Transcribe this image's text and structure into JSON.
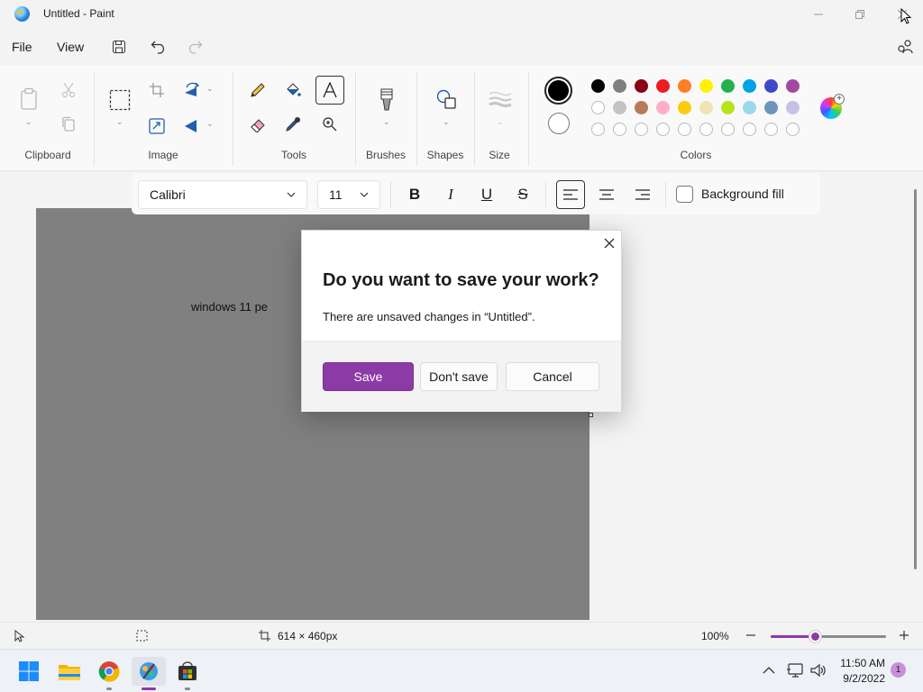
{
  "window": {
    "title": "Untitled - Paint"
  },
  "menu": {
    "file": "File",
    "view": "View"
  },
  "ribbon": {
    "groups": {
      "clipboard": "Clipboard",
      "image": "Image",
      "tools": "Tools",
      "brushes": "Brushes",
      "shapes": "Shapes",
      "size": "Size",
      "colors": "Colors"
    },
    "colors": {
      "primary": "#000000",
      "secondary": "#ffffff",
      "row1": [
        "#000000",
        "#7f7f7f",
        "#880015",
        "#ed1c24",
        "#ff7f27",
        "#fff200",
        "#22b14c",
        "#00a2e8",
        "#3f48cc",
        "#a349a4"
      ],
      "row2": [
        "#ffffff",
        "#c3c3c3",
        "#b97a57",
        "#ffaec9",
        "#ffc90e",
        "#efe4b0",
        "#b5e61d",
        "#99d9ea",
        "#7092be",
        "#c8bfe7"
      ],
      "row3_empty_count": 10
    }
  },
  "textbar": {
    "font": "Calibri",
    "size": "11",
    "background_fill": "Background fill"
  },
  "canvas": {
    "text": "windows 11 pe"
  },
  "dialog": {
    "title": "Do you want to save your work?",
    "message": "There are unsaved changes in “Untitled”.",
    "save": "Save",
    "dont_save": "Don't save",
    "cancel": "Cancel"
  },
  "status": {
    "canvas_size": "614 × 460px",
    "zoom": "100%",
    "zoom_fraction": 0.38
  },
  "taskbar": {
    "time": "11:50 AM",
    "date": "9/2/2022",
    "notifications": "1"
  },
  "accent": "#8c3aa6"
}
